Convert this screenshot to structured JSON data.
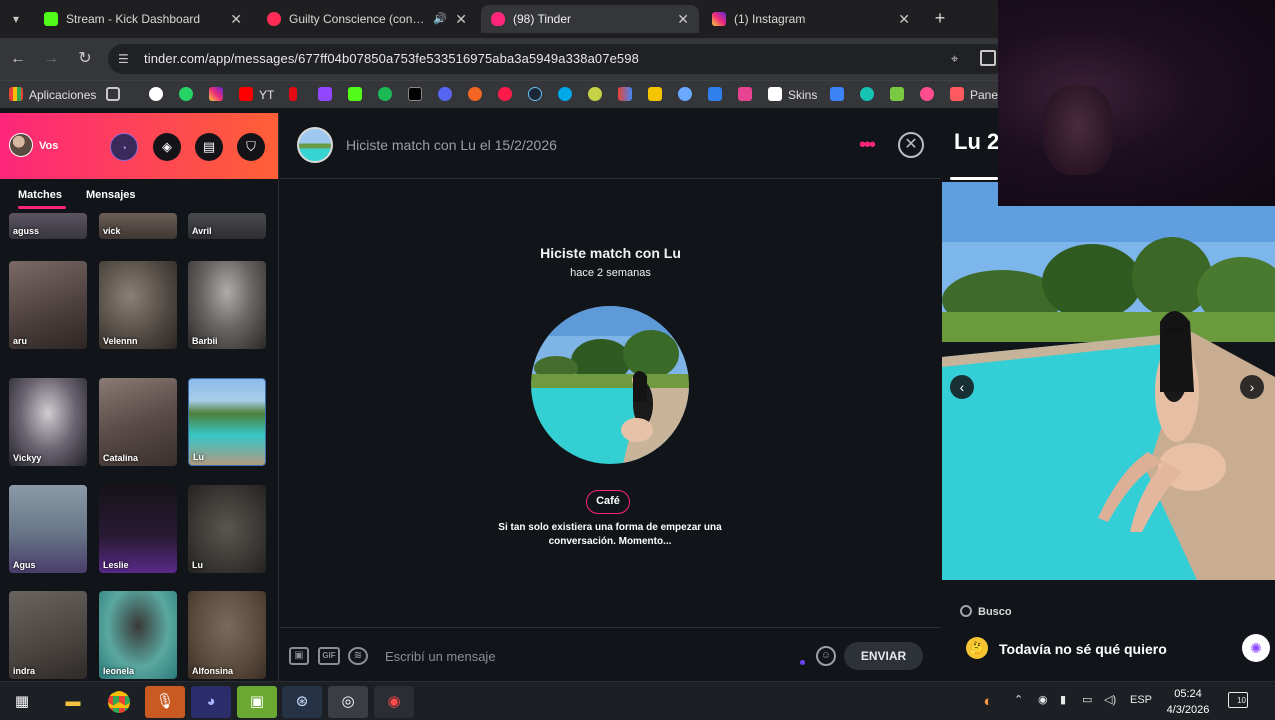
{
  "browser": {
    "tabs": [
      {
        "title": "Stream - Kick Dashboard",
        "color": "#53fc18",
        "active": false
      },
      {
        "title": "Guilty Conscience (con Dr. D",
        "color": "#ff2d55",
        "active": false,
        "audio": true
      },
      {
        "title": "(98) Tinder",
        "color": "#fd267a",
        "active": true
      },
      {
        "title": "(1) Instagram",
        "color": "#e1306c",
        "active": false
      }
    ],
    "url": "tinder.com/app/messages/677ff04b07850a753fe533516975aba3a5949a338a07e598",
    "bookmarks": {
      "apps_label": "Aplicaciones",
      "yt_label": "YT",
      "skins_label": "Skins",
      "panel_label": "Panel"
    }
  },
  "sidebar": {
    "me_label": "Vos",
    "tabs": [
      "Matches",
      "Mensajes"
    ],
    "matches": [
      {
        "name": "aguss"
      },
      {
        "name": "vick"
      },
      {
        "name": "Avril"
      },
      {
        "name": "aru"
      },
      {
        "name": "Velennn"
      },
      {
        "name": "Barbii"
      },
      {
        "name": "Vickyy"
      },
      {
        "name": "Catalina"
      },
      {
        "name": "Lu"
      },
      {
        "name": "Agus"
      },
      {
        "name": "Leslie"
      },
      {
        "name": "Lu"
      },
      {
        "name": "indra"
      },
      {
        "name": "leonela"
      },
      {
        "name": "Alfonsina"
      }
    ]
  },
  "chat": {
    "header_title": "Hiciste match con Lu el 15/2/2026",
    "match_title_prefix": "Hiciste match con ",
    "match_name": "Lu",
    "match_ago": "hace 2 semanas",
    "badge": "Café",
    "prompt": "Si tan solo existiera una forma de empezar una conversación. Momento...",
    "composer": {
      "placeholder": "Escribí un mensaje",
      "gif_label": "GIF",
      "send_label": "ENVIAR"
    }
  },
  "profile": {
    "name": "Lu 2",
    "looking_label": "Busco",
    "looking_value": "Todavía no sé qué quiero",
    "looking_emoji": "🤔"
  },
  "taskbar": {
    "language": "ESP",
    "time": "05:24",
    "date": "4/3/2026",
    "notifications": "10"
  },
  "colors": {
    "tinder_pink": "#fd267a",
    "tinder_orange": "#ff6036",
    "background": "#111418"
  }
}
